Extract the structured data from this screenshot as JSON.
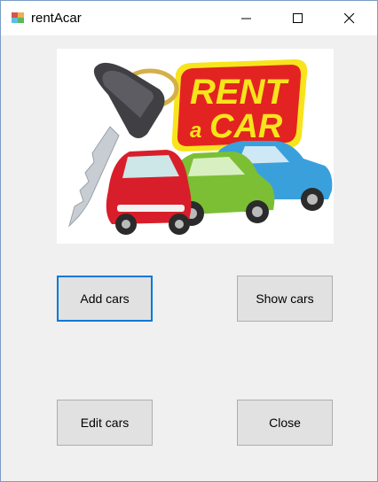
{
  "window": {
    "title": "rentAcar",
    "icon": "winforms-app-icon",
    "controls": [
      "minimize-icon",
      "maximize-icon",
      "close-icon"
    ]
  },
  "logo": {
    "sign_line1": "RENT",
    "sign_a": "a",
    "sign_line2": "CAR",
    "colors": {
      "sign_red": "#e32322",
      "sign_yellow": "#f7e41c",
      "car_red": "#d81e2a",
      "car_green": "#7cbf35",
      "car_blue": "#3aa0dc",
      "key_dark": "#3f3f44"
    }
  },
  "buttons": {
    "add": "Add cars",
    "show": "Show cars",
    "edit": "Edit cars",
    "close": "Close"
  },
  "accent": "#0078d7"
}
